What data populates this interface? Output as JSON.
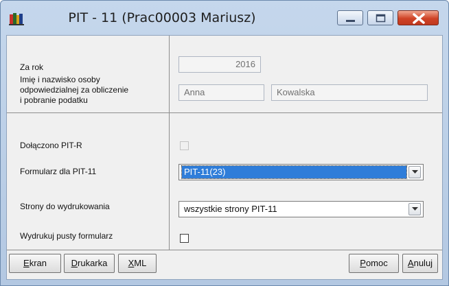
{
  "window": {
    "title": "PIT - 11 (Prac00003 Mariusz)",
    "icon": "app-books-icon"
  },
  "section_period": {
    "year_label": "Za rok",
    "year_value": "2016",
    "person_label_line1": "Imię i nazwisko osoby",
    "person_label_line2": "odpowiedzialnej za obliczenie",
    "person_label_line3": "i pobranie podatku",
    "first_name": "Anna",
    "last_name": "Kowalska"
  },
  "section_options": {
    "pitr_label": "Dołączono PIT-R",
    "pitr_checked": false,
    "form_label": "Formularz dla PIT-11",
    "form_value": "PIT-11(23)",
    "pages_label": "Strony do wydrukowania",
    "pages_value": "wszystkie strony PIT-11",
    "empty_form_label": "Wydrukuj pusty formularz",
    "empty_form_checked": false
  },
  "buttons": {
    "screen": {
      "mnemonic": "E",
      "rest": "kran"
    },
    "printer": {
      "mnemonic": "D",
      "rest": "rukarka"
    },
    "xml": {
      "mnemonic": "X",
      "rest": "ML"
    },
    "help": {
      "mnemonic": "P",
      "rest": "omoc"
    },
    "cancel": {
      "mnemonic": "A",
      "rest": "nuluj"
    }
  },
  "colors": {
    "titlebar": "#c5d7ec",
    "selection": "#2f7dd9",
    "close_button": "#cf4326"
  }
}
